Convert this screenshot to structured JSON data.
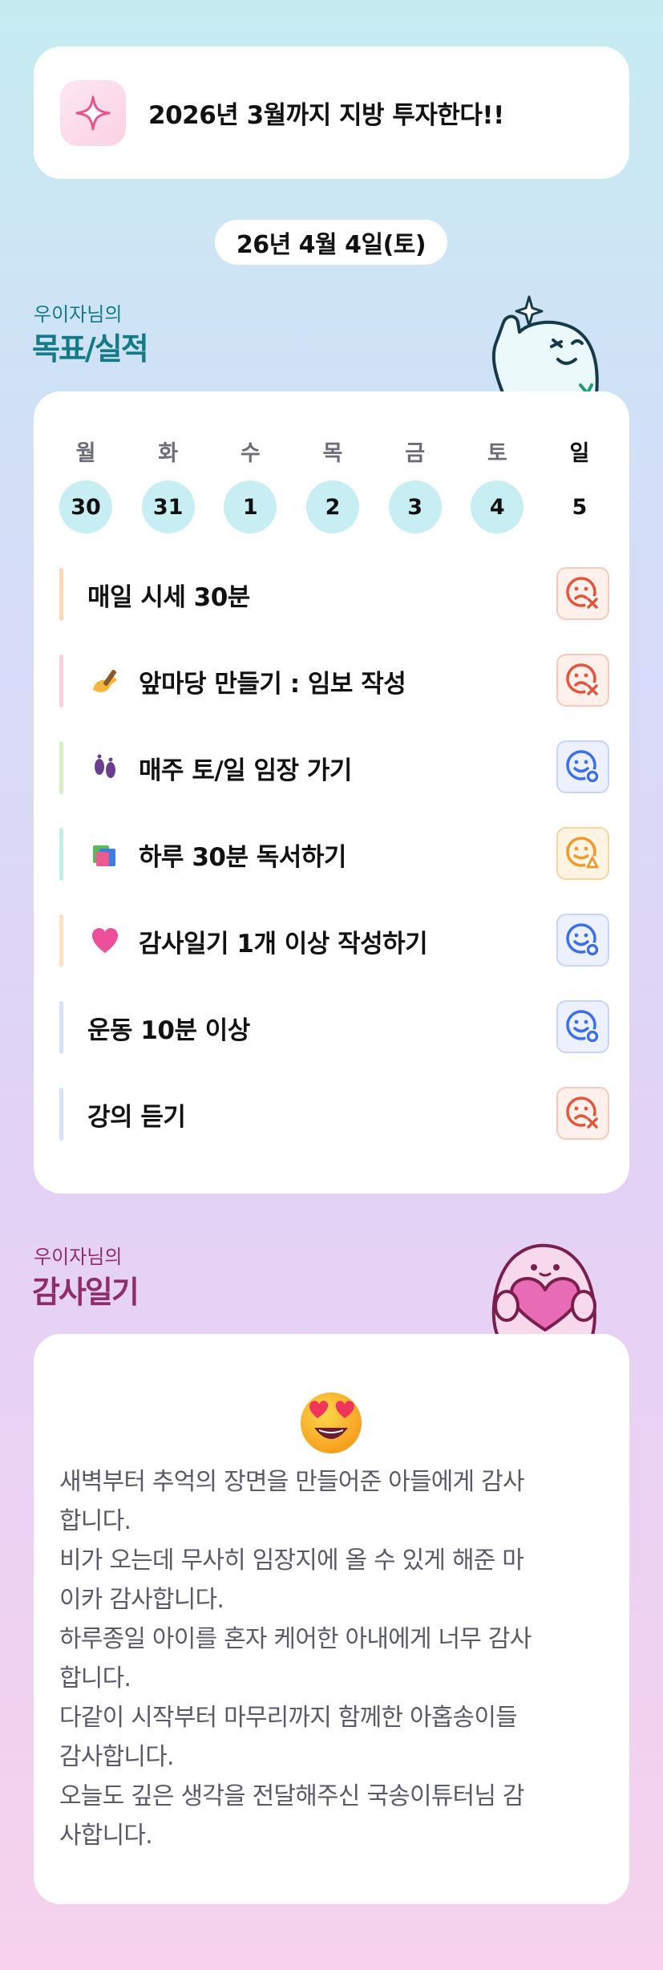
{
  "goal_banner": {
    "text": "2026년 3월까지 지방 투자한다!!",
    "icon": "sparkle-icon"
  },
  "date_pill": "26년 4월 4일(토)",
  "goals_section": {
    "subtitle": "우이자님의",
    "title": "목표/실적"
  },
  "week": {
    "days": [
      {
        "name": "월",
        "date": "30",
        "highlighted": true
      },
      {
        "name": "화",
        "date": "31",
        "highlighted": true
      },
      {
        "name": "수",
        "date": "1",
        "highlighted": true
      },
      {
        "name": "목",
        "date": "2",
        "highlighted": true
      },
      {
        "name": "금",
        "date": "3",
        "highlighted": true
      },
      {
        "name": "토",
        "date": "4",
        "highlighted": true
      },
      {
        "name": "일",
        "date": "5",
        "highlighted": false
      }
    ]
  },
  "goals": [
    {
      "label": "매일 시세 30분",
      "emoji": "",
      "status": "fail",
      "bar_color": "#fbd8b6"
    },
    {
      "label": "앞마당 만들기 : 임보 작성",
      "emoji": "writing-hand-icon",
      "status": "fail",
      "bar_color": "#f8d0d6"
    },
    {
      "label": "매주 토/일 임장 가기",
      "emoji": "footprints-icon",
      "status": "ok",
      "bar_color": "#d8f0c4"
    },
    {
      "label": "하루 30분 독서하기",
      "emoji": "books-icon",
      "status": "warn",
      "bar_color": "#c6efe3"
    },
    {
      "label": "감사일기 1개 이상 작성하기",
      "emoji": "pink-heart-icon",
      "status": "ok",
      "bar_color": "#fde2c4"
    },
    {
      "label": "운동 10분 이상",
      "emoji": "",
      "status": "ok",
      "bar_color": "#d7e3fb"
    },
    {
      "label": "강의 듣기",
      "emoji": "",
      "status": "fail",
      "bar_color": "#d7e3fb"
    }
  ],
  "gratitude_section": {
    "subtitle": "우이자님의",
    "title": "감사일기",
    "emoji": "heart-eyes-icon"
  },
  "gratitude_lines": [
    "새벽부터 추억의 장면을 만들어준 아들에게 감사",
    "합니다.",
    "비가 오는데 무사히 임장지에 올 수 있게 해준 마",
    "이카 감사합니다.",
    "하루종일 아이를 혼자 케어한 아내에게 너무 감사",
    "합니다.",
    "다같이 시작부터 마무리까지 함께한 아홉송이들",
    "감사합니다.",
    "오늘도 깊은 생각을 전달해주신 국송이튜터님 감",
    "사합니다."
  ],
  "colors": {
    "accent_teal": "#137b87",
    "accent_plum": "#8e2d6a",
    "date_highlight": "#c6eef3"
  }
}
